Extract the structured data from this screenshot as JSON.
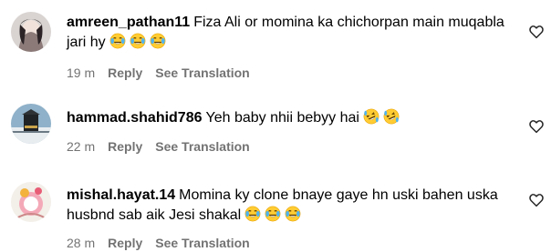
{
  "comments": [
    {
      "username": "amreen_pathan11",
      "text": "Fiza Ali or momina ka chichorpan main muqabla jari hy",
      "emoji": [
        "face-with-tears-of-joy-icon",
        "face-with-tears-of-joy-icon",
        "face-with-tears-of-joy-icon"
      ],
      "time": "19 m",
      "reply": "Reply",
      "translation": "See Translation"
    },
    {
      "username": "hammad.shahid786",
      "text": "Yeh baby nhii bebyy hai",
      "emoji": [
        "rolling-on-floor-laughing-icon",
        "rolling-on-floor-laughing-icon"
      ],
      "time": "22 m",
      "reply": "Reply",
      "translation": "See Translation"
    },
    {
      "username": "mishal.hayat.14",
      "text": "Momina ky clone bnaye gaye hn uski bahen uska husbnd sab aik Jesi shakal",
      "emoji": [
        "face-with-tears-of-joy-icon",
        "face-with-tears-of-joy-icon",
        "face-with-tears-of-joy-icon"
      ],
      "time": "28 m",
      "reply": "Reply",
      "translation": "See Translation"
    }
  ]
}
